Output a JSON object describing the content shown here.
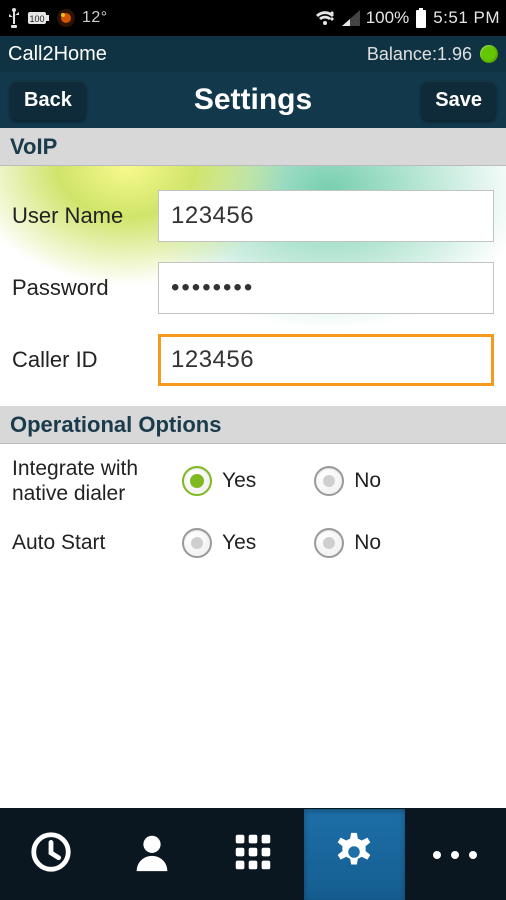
{
  "statusbar": {
    "temp": "12°",
    "battery_percent": "100%",
    "battery_small_label": "100",
    "time": "5:51 PM"
  },
  "balancebar": {
    "app_title": "Call2Home",
    "balance_label": "Balance:",
    "balance_value": "1.96"
  },
  "toolbar": {
    "back_label": "Back",
    "title": "Settings",
    "save_label": "Save"
  },
  "sections": {
    "voip_header": "VoIP",
    "operational_header": "Operational Options"
  },
  "voip": {
    "username_label": "User Name",
    "username_value": "123456",
    "password_label": "Password",
    "password_value": "••••••••",
    "callerid_label": "Caller ID",
    "callerid_value": "123456"
  },
  "opoptions": {
    "integrate_label": "Integrate with native dialer",
    "autostart_label": "Auto Start",
    "yes_label": "Yes",
    "no_label": "No",
    "integrate_selected": "yes",
    "autostart_selected": ""
  },
  "nav": {
    "items": [
      "recent",
      "contacts",
      "keypad",
      "settings",
      "more"
    ],
    "active": "settings"
  }
}
